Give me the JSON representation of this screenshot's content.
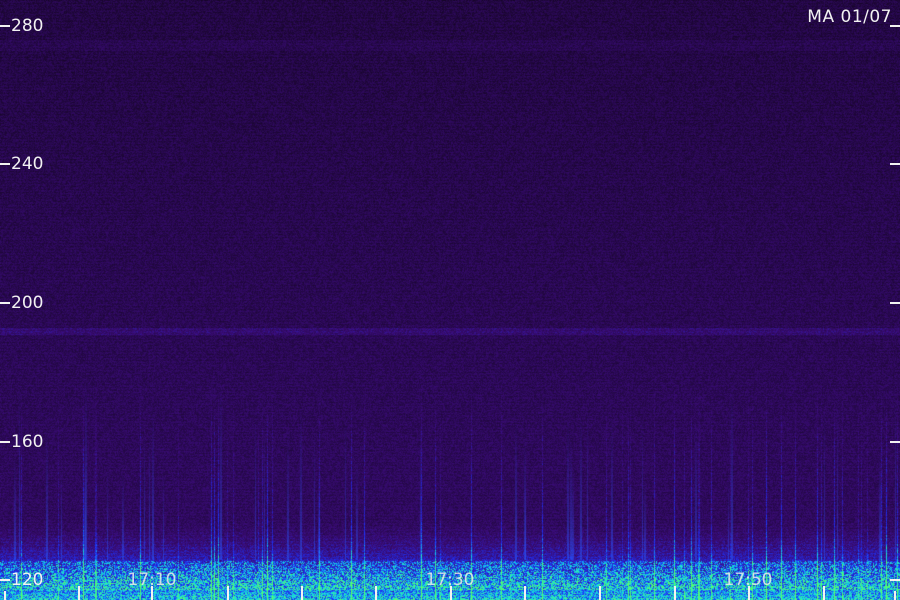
{
  "station_label": "MA 01/07",
  "y_axis": {
    "ticks": [
      "280",
      "240",
      "200",
      "160",
      "120"
    ]
  },
  "x_axis": {
    "time_labels": [
      "17:10",
      "17:30",
      "17:50"
    ]
  },
  "colors": {
    "background_low": "#12061f",
    "background_mid": "#3a0c7a",
    "signal_blue": "#1a3cff",
    "signal_cyan": "#1fd8e8",
    "signal_green": "#4dff6a",
    "axis_marks": "#f2f2f2"
  }
}
